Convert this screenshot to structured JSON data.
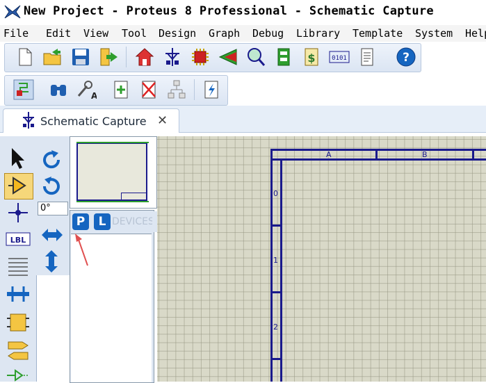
{
  "window": {
    "title": "New Project - Proteus 8 Professional - Schematic Capture",
    "app_icon": "proteus-app-icon"
  },
  "menu": [
    "File",
    "Edit",
    "View",
    "Tool",
    "Design",
    "Graph",
    "Debug",
    "Library",
    "Template",
    "System",
    "Help"
  ],
  "toolbar1": [
    "new-file-icon",
    "open-folder-icon",
    "save-disk-icon",
    "close-project-icon",
    "home-icon",
    "schematic-icon",
    "pcb-layout-icon",
    "3d-viewer-icon",
    "gerber-viewer-icon",
    "design-explorer-icon",
    "bill-of-materials-icon",
    "source-code-icon",
    "notes-icon",
    "help-icon"
  ],
  "toolbar2": [
    "schematic-mode-icon",
    "search-binoculars-icon",
    "property-tool-icon",
    "new-sheet-icon",
    "delete-sheet-icon",
    "goto-parent-icon",
    "electrical-rule-check-icon"
  ],
  "tab": {
    "label": "Schematic Capture",
    "close_glyph": "✕"
  },
  "left_tools": [
    "selection-mode-icon",
    "component-mode-icon",
    "junction-dot-icon",
    "wire-label-icon",
    "text-script-icon",
    "buses-icon",
    "subcircuit-icon",
    "terminals-icon",
    "device-pins-icon"
  ],
  "rotation": {
    "angle": "0°"
  },
  "device_selector": {
    "pick_button": "P",
    "library_button": "L",
    "header": "DEVICES"
  },
  "sheet": {
    "columns": [
      "A",
      "B"
    ],
    "rows": [
      "0",
      "1",
      "2"
    ]
  },
  "colors": {
    "frame": "#1a1a8c",
    "canvas": "#d9d9c8",
    "accent": "#1565c0",
    "annotation": "#e05050"
  }
}
